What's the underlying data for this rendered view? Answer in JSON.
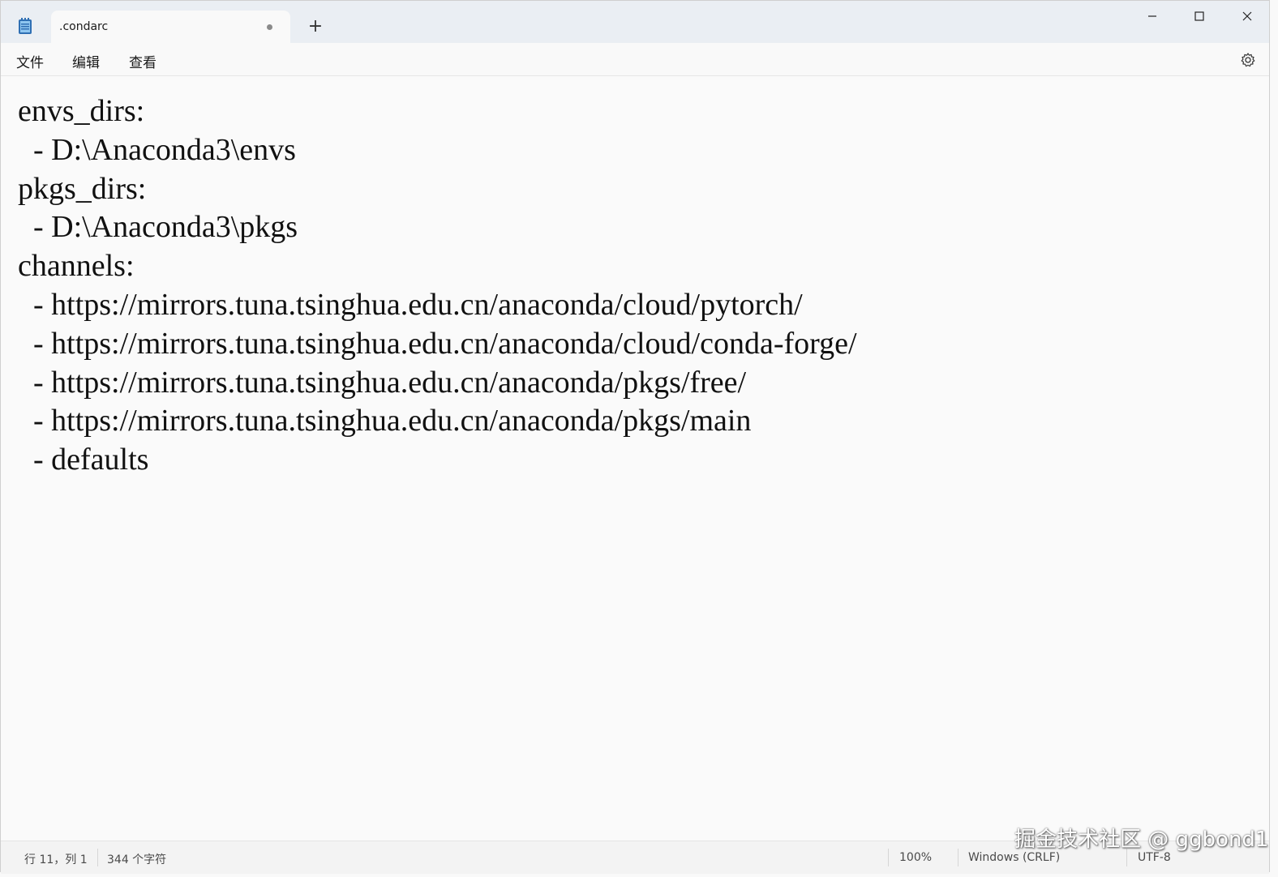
{
  "window": {
    "tab_title": ".condarc",
    "new_tab_symbol": "+"
  },
  "menu": {
    "file": "文件",
    "edit": "编辑",
    "view": "查看"
  },
  "editor": {
    "lines": [
      "envs_dirs:",
      "  - D:\\Anaconda3\\envs",
      "pkgs_dirs:",
      "  - D:\\Anaconda3\\pkgs",
      "channels:",
      "  - https://mirrors.tuna.tsinghua.edu.cn/anaconda/cloud/pytorch/",
      "  - https://mirrors.tuna.tsinghua.edu.cn/anaconda/cloud/conda-forge/",
      "  - https://mirrors.tuna.tsinghua.edu.cn/anaconda/pkgs/free/",
      "  - https://mirrors.tuna.tsinghua.edu.cn/anaconda/pkgs/main",
      "  - defaults"
    ]
  },
  "status": {
    "position": "行 11，列 1",
    "char_count": "344 个字符",
    "zoom": "100%",
    "line_ending": "Windows (CRLF)",
    "encoding": "UTF-8"
  },
  "watermark": "掘金技术社区 @ ggbond1",
  "icons": {
    "app": "notepad-icon",
    "settings": "gear-icon",
    "minimize": "minimize-icon",
    "maximize": "maximize-icon",
    "close": "close-icon"
  },
  "colors": {
    "titlebar": "#eaeef3",
    "editor_bg": "#fafafa",
    "text": "#111111"
  }
}
